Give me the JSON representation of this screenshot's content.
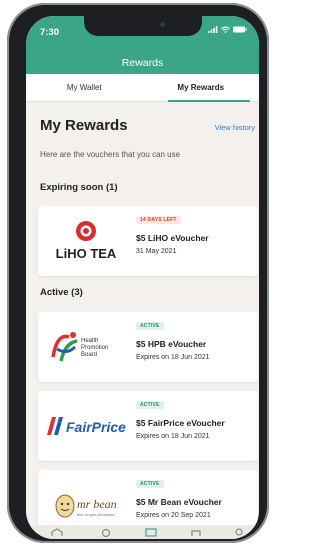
{
  "status_bar": {
    "time": "7:30"
  },
  "header": {
    "title": "Rewards"
  },
  "tabs": [
    {
      "label": "My Wallet",
      "active": false
    },
    {
      "label": "My Rewards",
      "active": true
    }
  ],
  "page": {
    "title": "My Rewards",
    "view_history": "View history",
    "subtitle": "Here are the vouchers that you can use"
  },
  "sections": {
    "expiring": "Expiring soon (1)",
    "active": "Active (3)"
  },
  "vouchers": [
    {
      "badge": "14 DAYS LEFT",
      "title": "$5 LiHO eVoucher",
      "detail": "31 May 2021",
      "logo_text": "LiHO TEA"
    },
    {
      "badge": "ACTIVE",
      "title": "$5 HPB eVoucher",
      "detail": "Expires on 18 Jun 2021",
      "logo_text": "Health Promotion Board"
    },
    {
      "badge": "ACTIVE",
      "title": "$5 FairPrice eVoucher",
      "detail": "Expires on 18 Jun 2021",
      "logo_text": "FairPrice"
    },
    {
      "badge": "ACTIVE",
      "title": "$5 Mr Bean eVoucher",
      "detail": "Expires on 20 Sep 2021",
      "logo_text": "mr bean"
    }
  ],
  "colors": {
    "brand": "#3aa686",
    "link": "#2a7fc1",
    "warn_badge": "#c2462d",
    "ok_badge": "#2b8f6e"
  }
}
